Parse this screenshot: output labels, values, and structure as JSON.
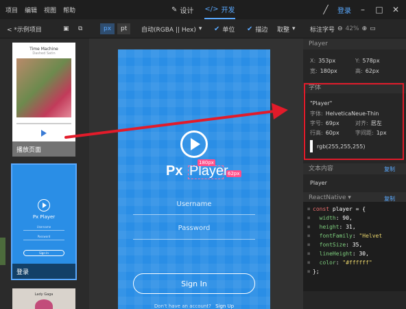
{
  "titlebar": {
    "menu": [
      "项目",
      "编辑",
      "视图",
      "帮助"
    ],
    "modes": [
      {
        "label": "设计",
        "active": false
      },
      {
        "label": "开发",
        "active": true
      }
    ],
    "login": "登录"
  },
  "toolbar": {
    "back_label": "< *示例项目",
    "unit_px": "px",
    "unit_pt": "pt",
    "color_format": "自动(RGBA || Hex)",
    "unit_check": "单位",
    "stroke_check": "描边",
    "round_label": "取整",
    "mark_label": "标注字号",
    "zoom": "42%"
  },
  "left_panel": {
    "thumbs": [
      {
        "caption": "播放页面",
        "title": "Time Machine",
        "subtitle": "Dashed Satin"
      },
      {
        "caption": "登录",
        "brand": "Px Player",
        "field1": "Username",
        "field2": "Password",
        "button": "Sign In"
      },
      {
        "caption": "",
        "title": "Lady Gaga"
      }
    ]
  },
  "artboard": {
    "logo_px": "Px",
    "logo_player": "Player",
    "width_tag": "180px",
    "height_tag": "62px",
    "username": "Username",
    "password": "Password",
    "signin": "Sign In",
    "no_account": "Don't have an account?",
    "signup": "Sign Up"
  },
  "inspector": {
    "layer_name": "Player",
    "x_label": "X:",
    "x_value": "353px",
    "y_label": "Y:",
    "y_value": "578px",
    "w_label": "宽:",
    "w_value": "180px",
    "h_label": "高:",
    "h_value": "62px",
    "font_head": "字体",
    "font_text": "\"Player\"",
    "font_label": "字体:",
    "font_value": "HelveticaNeue-Thin",
    "size_label": "字号:",
    "size_value": "69px",
    "align_label": "对齐:",
    "align_value": "居左",
    "lineh_label": "行高:",
    "lineh_value": "60px",
    "spacing_label": "字间距:",
    "spacing_value": "1px",
    "color_value": "rgb(255,255,255)",
    "content_head": "文本内容",
    "copy_label": "复制",
    "content_value": "Player",
    "framework": "ReactNative",
    "copy2_label": "复制",
    "code": [
      {
        "a": "const ",
        "b": "player",
        "c": " = {"
      },
      {
        "a": "  ",
        "b": "width",
        "c": ": ",
        "d": "90",
        "e": ","
      },
      {
        "a": "  ",
        "b": "height",
        "c": ": ",
        "d": "31",
        "e": ","
      },
      {
        "a": "  ",
        "b": "fontFamily",
        "c": ": ",
        "d": "\"Helvet",
        "e": ""
      },
      {
        "a": "  ",
        "b": "fontSize",
        "c": ": ",
        "d": "35",
        "e": ","
      },
      {
        "a": "  ",
        "b": "lineHeight",
        "c": ": ",
        "d": "30",
        "e": ","
      },
      {
        "a": "  ",
        "b": "color",
        "c": ": ",
        "d": "\"#ffffff\"",
        "e": ""
      },
      {
        "a": "};",
        "b": "",
        "c": "",
        "d": "",
        "e": ""
      }
    ]
  },
  "colors": {
    "accent": "#5aa9ff",
    "artboard_blue": "#2a8ee6",
    "highlight_red": "#e21b2a",
    "dim_pink": "#ff4f8b"
  }
}
